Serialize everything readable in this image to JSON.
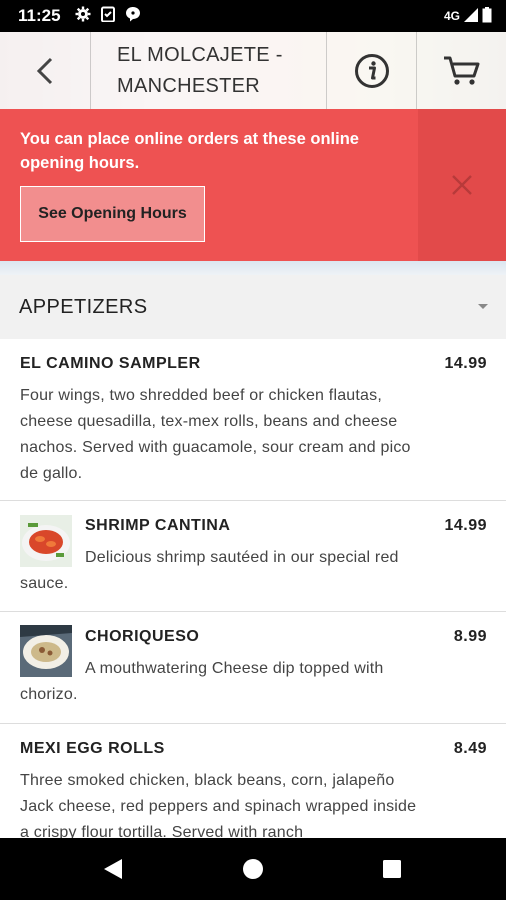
{
  "status_bar": {
    "time": "11:25",
    "network": "4G"
  },
  "header": {
    "title_line1": "EL MOLCAJETE -",
    "title_line2": "MANCHESTER",
    "back_icon": "chevron-left-icon",
    "info_icon": "info-icon",
    "cart_icon": "cart-icon"
  },
  "banner": {
    "message": "You can place online orders at these online opening hours.",
    "button_label": "See Opening Hours",
    "close_icon": "close-icon",
    "color": "#ee5252"
  },
  "category": {
    "title": "APPETIZERS"
  },
  "items": [
    {
      "name": "EL CAMINO SAMPLER",
      "price": "14.99",
      "description": "Four wings, two shredded beef or chicken flautas, cheese quesadilla, tex-mex rolls, beans and cheese nachos. Served with guacamole, sour cream and pico de gallo."
    },
    {
      "name": "SHRIMP CANTINA",
      "price": "14.99",
      "description": "Delicious shrimp sautéed in our special red sauce."
    },
    {
      "name": "CHORIQUESO",
      "price": "8.99",
      "description": "A mouthwatering Cheese dip topped with chorizo."
    },
    {
      "name": "MEXI EGG ROLLS",
      "price": "8.49",
      "description": "Three smoked chicken, black beans, corn, jalapeño Jack cheese, red peppers and spinach wrapped inside a crispy flour tortilla. Served with ranch"
    }
  ]
}
